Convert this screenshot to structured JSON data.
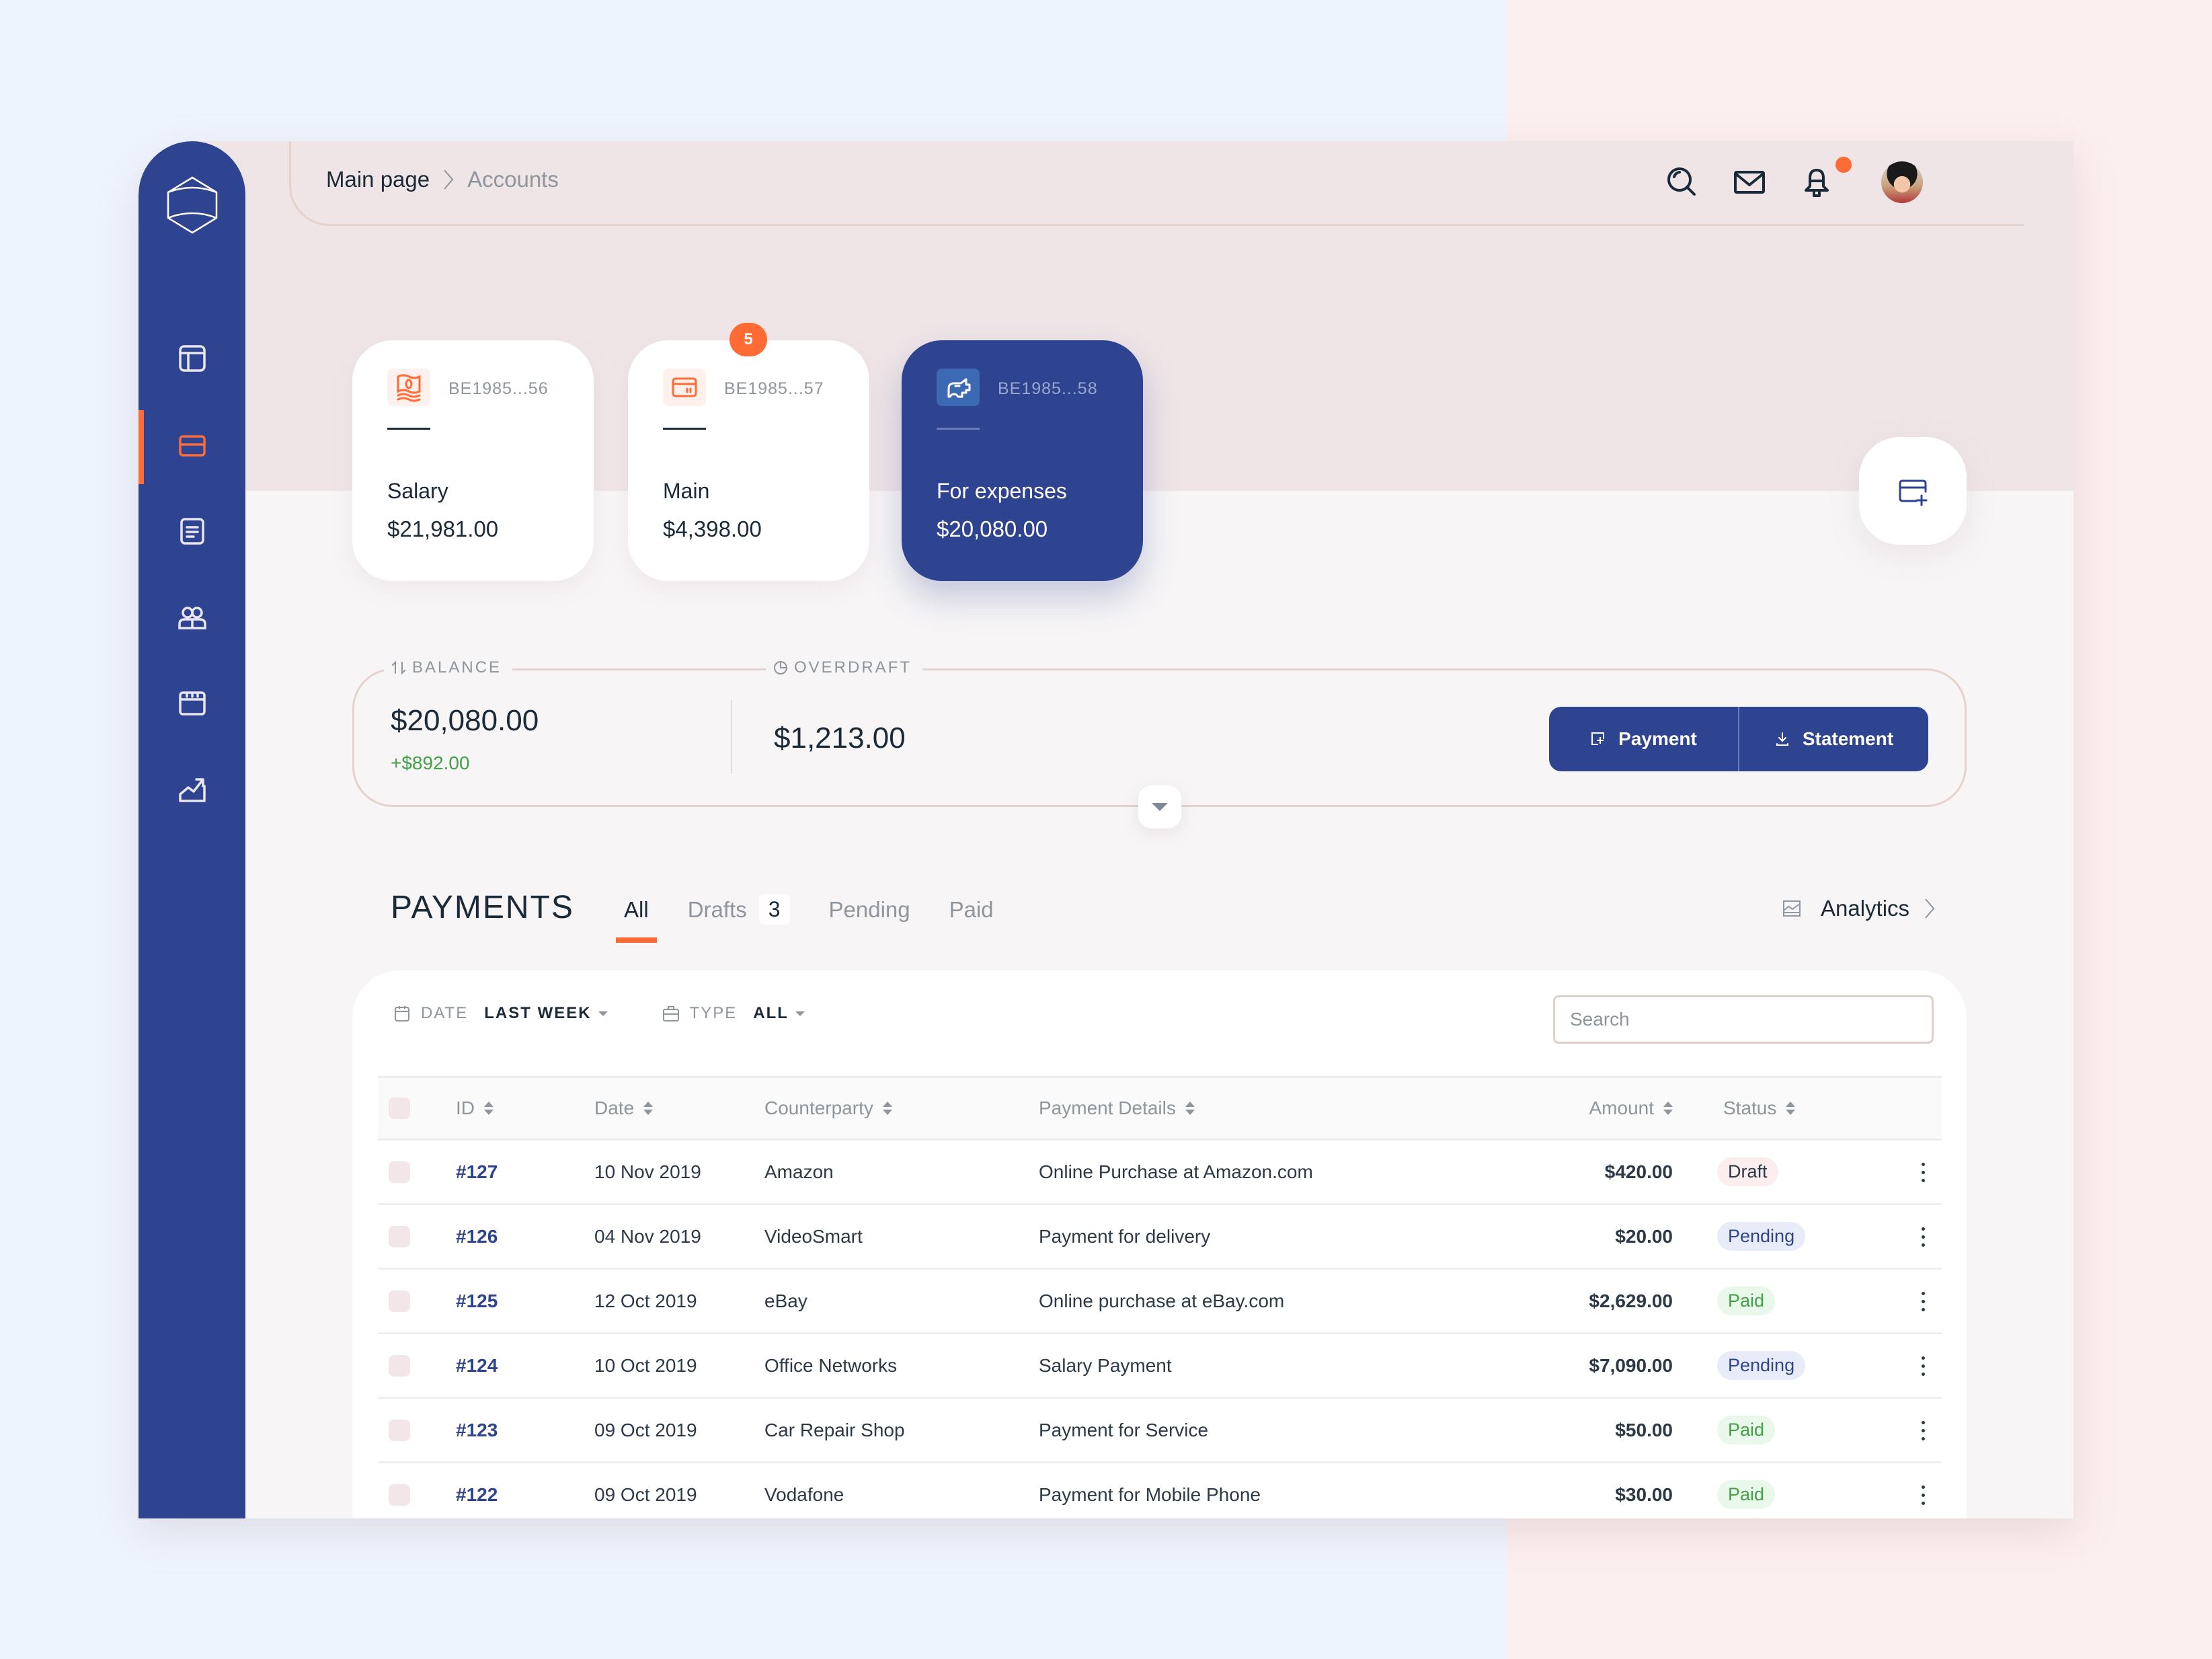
{
  "colors": {
    "brand_blue": "#2F4490",
    "accent_orange": "#FF6B35",
    "paid_green": "#43A047",
    "text_dark": "#1B2A38",
    "text_muted": "#8E959C"
  },
  "sidebar": {
    "logo": "hexagon-logo-icon",
    "items": [
      {
        "name": "dashboard",
        "icon": "dashboard-icon",
        "active": false
      },
      {
        "name": "accounts",
        "icon": "card-icon",
        "active": true
      },
      {
        "name": "documents",
        "icon": "document-icon",
        "active": false
      },
      {
        "name": "contacts",
        "icon": "users-icon",
        "active": false
      },
      {
        "name": "calendar",
        "icon": "calendar-icon",
        "active": false
      },
      {
        "name": "analytics",
        "icon": "chart-icon",
        "active": false
      }
    ]
  },
  "header": {
    "breadcrumb": [
      "Main page",
      "Accounts"
    ],
    "icons": [
      "search-icon",
      "mail-icon",
      "bell-icon",
      "avatar"
    ],
    "has_notification": true
  },
  "accounts": [
    {
      "number": "BE1985...56",
      "name": "Salary",
      "amount": "$21,981.00",
      "icon": "money-icon",
      "badge": null,
      "selected": false
    },
    {
      "number": "BE1985...57",
      "name": "Main",
      "amount": "$4,398.00",
      "icon": "card-icon",
      "badge": "5",
      "selected": false
    },
    {
      "number": "BE1985...58",
      "name": "For expenses",
      "amount": "$20,080.00",
      "icon": "piggy-bank-icon",
      "badge": null,
      "selected": true
    }
  ],
  "balance": {
    "label": "BALANCE",
    "amount": "$20,080.00",
    "change": "+$892.00",
    "overdraft_label": "OVERDRAFT",
    "overdraft_amount": "$1,213.00",
    "payment_button": "Payment",
    "statement_button": "Statement"
  },
  "payments": {
    "title": "PAYMENTS",
    "tabs": [
      {
        "label": "All",
        "count": null,
        "active": true
      },
      {
        "label": "Drafts",
        "count": "3",
        "active": false
      },
      {
        "label": "Pending",
        "count": null,
        "active": false
      },
      {
        "label": "Paid",
        "count": null,
        "active": false
      }
    ],
    "analytics_link": "Analytics",
    "filters": {
      "date_label": "DATE",
      "date_value": "LAST WEEK",
      "type_label": "TYPE",
      "type_value": "ALL"
    },
    "search_placeholder": "Search",
    "columns": [
      "ID",
      "Date",
      "Counterparty",
      "Payment Details",
      "Amount",
      "Status"
    ],
    "rows": [
      {
        "id": "#127",
        "date": "10 Nov 2019",
        "counterparty": "Amazon",
        "details": "Online Purchase at Amazon.com",
        "amount": "$420.00",
        "status": "Draft"
      },
      {
        "id": "#126",
        "date": "04 Nov 2019",
        "counterparty": "VideoSmart",
        "details": "Payment for delivery",
        "amount": "$20.00",
        "status": "Pending"
      },
      {
        "id": "#125",
        "date": "12 Oct 2019",
        "counterparty": "eBay",
        "details": "Online purchase at eBay.com",
        "amount": "$2,629.00",
        "status": "Paid"
      },
      {
        "id": "#124",
        "date": "10 Oct 2019",
        "counterparty": "Office Networks",
        "details": "Salary Payment",
        "amount": "$7,090.00",
        "status": "Pending"
      },
      {
        "id": "#123",
        "date": "09 Oct 2019",
        "counterparty": "Car Repair Shop",
        "details": "Payment for Service",
        "amount": "$50.00",
        "status": "Paid"
      },
      {
        "id": "#122",
        "date": "09 Oct 2019",
        "counterparty": "Vodafone",
        "details": "Payment for Mobile Phone",
        "amount": "$30.00",
        "status": "Paid"
      }
    ]
  }
}
